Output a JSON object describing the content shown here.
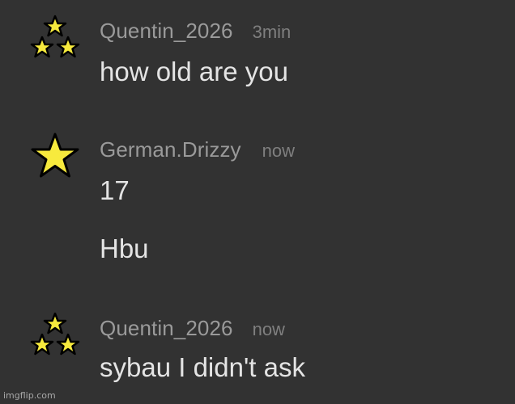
{
  "colors": {
    "background": "#323232",
    "username": "#9a9a9a",
    "timestamp": "#7f7f7f",
    "message": "#e4e4e4",
    "star_fill": "#f7ea3d",
    "star_outline": "#000000"
  },
  "messages": [
    {
      "avatar_icon": "three-stars-icon",
      "username": "Quentin_2026",
      "time": "3min",
      "lines": [
        "how old are you"
      ]
    },
    {
      "avatar_icon": "star-icon",
      "username": "German.Drizzy",
      "time": "now",
      "lines": [
        "17",
        "Hbu"
      ]
    },
    {
      "avatar_icon": "three-stars-icon",
      "username": "Quentin_2026",
      "time": "now",
      "lines": [
        "sybau I didn't ask"
      ]
    }
  ],
  "watermark": "imgflip.com"
}
